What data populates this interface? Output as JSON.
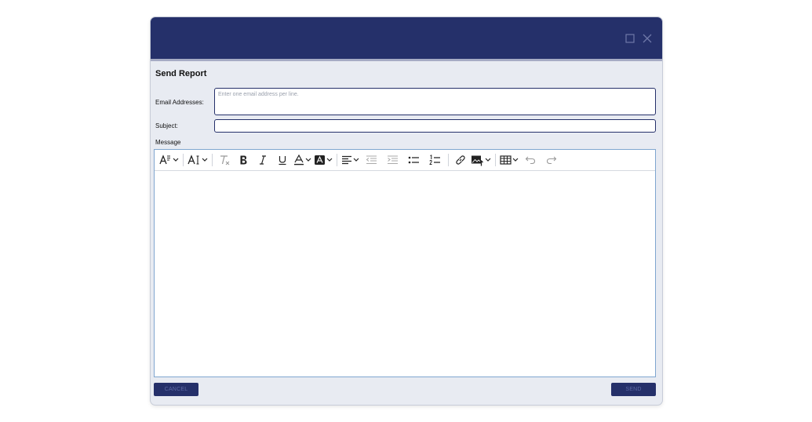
{
  "dialog": {
    "title": "Send Report",
    "email_label": "Email Addresses:",
    "email_placeholder": "Enter one email address per line.",
    "email_value": "",
    "subject_label": "Subject:",
    "subject_value": "",
    "message_label": "Message",
    "cancel_label": "CANCEL",
    "send_label": "SEND"
  },
  "colors": {
    "titlebar": "#25306a",
    "dialog_bg": "#e8ebf2",
    "button_bg": "#25306a",
    "editor_border": "#7fa6cf"
  },
  "toolbar_icons": [
    "heading-icon",
    "font-size-icon",
    "remove-format-icon",
    "bold-icon",
    "italic-icon",
    "underline-icon",
    "font-color-icon",
    "highlight-icon",
    "align-icon",
    "outdent-icon",
    "indent-icon",
    "bulleted-list-icon",
    "numbered-list-icon",
    "link-icon",
    "insert-image-icon",
    "table-icon",
    "undo-icon",
    "redo-icon"
  ]
}
